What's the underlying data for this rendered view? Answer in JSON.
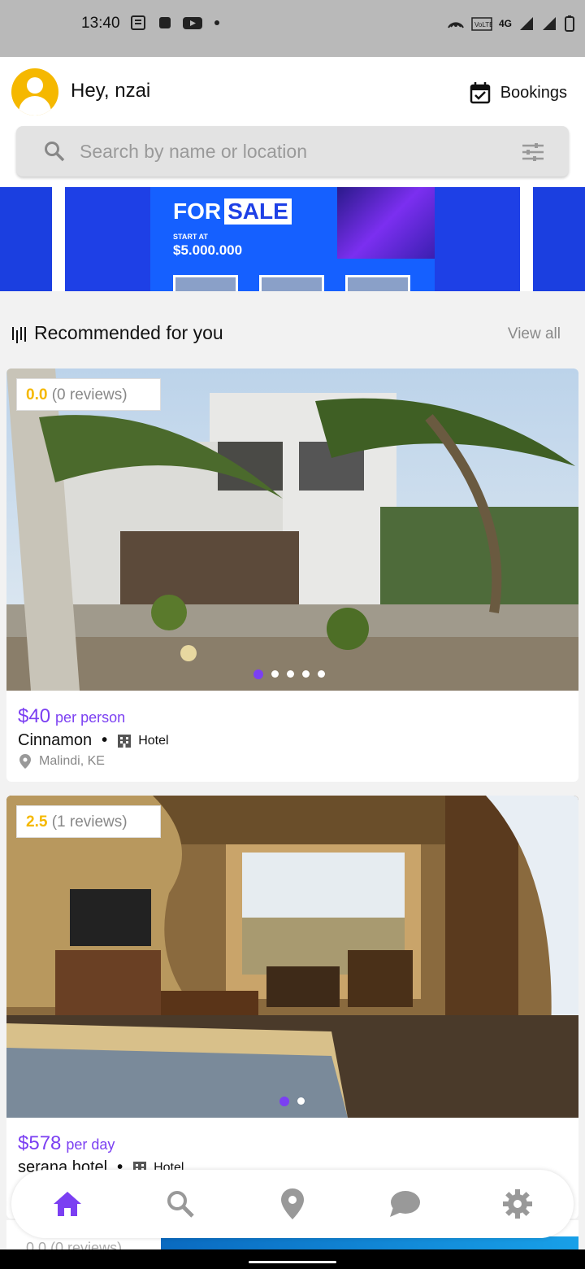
{
  "status_bar": {
    "time": "13:40",
    "network": "4G"
  },
  "header": {
    "greeting": "Hey, nzai",
    "bookings_label": "Bookings"
  },
  "search": {
    "placeholder": "Search by name or location"
  },
  "banner": {
    "headline_word": "FOR",
    "headline_highlight": "SALE",
    "start_at": "START AT",
    "price": "$5.000.000"
  },
  "recommended": {
    "title": "Recommended for you",
    "view_all": "View all"
  },
  "listings": [
    {
      "rating": "0.0",
      "reviews": "(0 reviews)",
      "price": "$40",
      "unit": "per person",
      "name": "Cinnamon",
      "type": "Hotel",
      "location": "Malindi, KE",
      "photo_count": 5,
      "active_photo": 1
    },
    {
      "rating": "2.5",
      "reviews": "(1 reviews)",
      "price": "$578",
      "unit": "per day",
      "name": "serana hotel",
      "type": "Hotel",
      "photo_count": 2,
      "active_photo": 1
    },
    {
      "rating": "0.0",
      "reviews": "(0 reviews)"
    }
  ],
  "nav": {
    "items": [
      "home",
      "search",
      "map",
      "messages",
      "settings"
    ],
    "active": "home"
  },
  "colors": {
    "accent": "#7b3ff2",
    "rating": "#f5b800"
  }
}
